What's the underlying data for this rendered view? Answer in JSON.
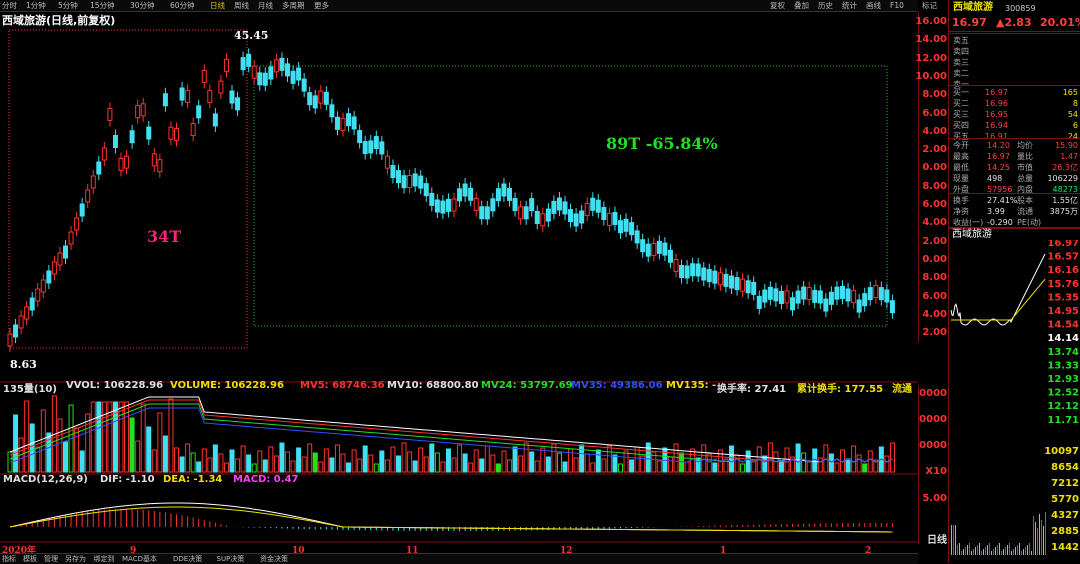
{
  "toolbar": {
    "items": [
      "分时",
      "1分钟",
      "5分钟",
      "15分钟",
      "30分钟",
      "60分钟",
      "日线",
      "周线",
      "月线",
      "多周期",
      "更多"
    ],
    "active": "日线",
    "right_items": [
      "复权",
      "叠加",
      "历史",
      "统计",
      "画线",
      "F10",
      "标记"
    ]
  },
  "chart": {
    "title": "西域旅游(日线,前复权)",
    "high_label": "45.45",
    "low_label": "8.63",
    "annotation_34t": "34T",
    "annotation_89t": "89T -65.84%",
    "month_labels": [
      "2020年",
      "9",
      "10",
      "11",
      "12",
      "1",
      "2"
    ],
    "price_axis": [
      "16.00",
      "14.00",
      "12.00",
      "10.00",
      "8.00",
      "6.00",
      "4.00",
      "2.00",
      "0.00",
      "8.00",
      "6.00",
      "4.00",
      "2.00",
      "0.00",
      "8.00",
      "6.00",
      "4.00",
      "2.00"
    ],
    "vol_axis": [
      "0000",
      "0000",
      "0000",
      "X10"
    ],
    "macd_axis": [
      "5.00"
    ],
    "period_label": "日线"
  },
  "indicators": {
    "vol_name": "135量(10)",
    "vvol": "VVOL: 106228.96",
    "volume": "VOLUME: 106228.96",
    "mv5": "MV5: 68746.36",
    "mv10": "MV10: 68800.80",
    "mv24": "MV24: 53797.69",
    "mv35": "MV35: 49386.06",
    "mv135": "MV135: -",
    "turnover": "换手率: 27.41",
    "cum_turnover": "累计换手: 177.55",
    "float": "流通",
    "macd_name": "MACD(12,26,9)",
    "dif": "DIF: -1.10",
    "dea": "DEA: -1.34",
    "macd": "MACD: 0.47"
  },
  "quote": {
    "name": "西域旅游",
    "code": "300859",
    "price": "16.97",
    "change": "▲2.83",
    "pct": "20.01%",
    "asks": [
      {
        "label": "卖五",
        "price": "",
        "vol": ""
      },
      {
        "label": "卖四",
        "price": "",
        "vol": ""
      },
      {
        "label": "卖三",
        "price": "",
        "vol": ""
      },
      {
        "label": "卖二",
        "price": "",
        "vol": ""
      },
      {
        "label": "卖一",
        "price": "",
        "vol": ""
      }
    ],
    "bids": [
      {
        "label": "买一",
        "price": "16.97",
        "vol": "165"
      },
      {
        "label": "买二",
        "price": "16.96",
        "vol": "8"
      },
      {
        "label": "买三",
        "price": "16.95",
        "vol": "54"
      },
      {
        "label": "买四",
        "price": "16.94",
        "vol": "6"
      },
      {
        "label": "买五",
        "price": "16.91",
        "vol": "24"
      }
    ],
    "stats": [
      {
        "k1": "今开",
        "v1": "14.20",
        "k2": "均价",
        "v2": "15.90"
      },
      {
        "k1": "最高",
        "v1": "16.97",
        "k2": "量比",
        "v2": "1.47"
      },
      {
        "k1": "最低",
        "v1": "14.25",
        "k2": "市值",
        "v2": "26.3亿"
      },
      {
        "k1": "现量",
        "v1": "498",
        "k2": "总量",
        "v2": "106229"
      },
      {
        "k1": "外盘",
        "v1": "57956",
        "k2": "内盘",
        "v2": "48273"
      }
    ],
    "stats2": [
      {
        "k1": "换手",
        "v1": "27.41%",
        "k2": "股本",
        "v2": "1.55亿"
      },
      {
        "k1": "净资",
        "v1": "3.99",
        "k2": "流通",
        "v2": "3875万"
      },
      {
        "k1": "收益(一)",
        "v1": "-0.290",
        "k2": "PE(动)",
        "v2": ""
      }
    ],
    "mini_title": "西域旅游",
    "mini_axis": [
      "16.97",
      "16.57",
      "16.16",
      "15.76",
      "15.35",
      "14.95",
      "14.54",
      "14.14",
      "13.74",
      "13.33",
      "12.93",
      "12.52",
      "12.12",
      "11.71"
    ],
    "mini_vol_axis": [
      "10097",
      "8654",
      "7212",
      "5770",
      "4327",
      "2885",
      "1442"
    ]
  },
  "bottom": {
    "items": [
      "指标",
      "模板",
      "管理",
      "另存为",
      "绑定到",
      "MACD基本",
      "DDE决策",
      "SUP决策",
      "资金决策"
    ]
  },
  "colors": {
    "up": "#ff3030",
    "down": "#40e0f0",
    "ma5": "#ffffff",
    "ma10": "#ffff00",
    "ma24": "#ff00ff",
    "ma35": "#20e020"
  }
}
